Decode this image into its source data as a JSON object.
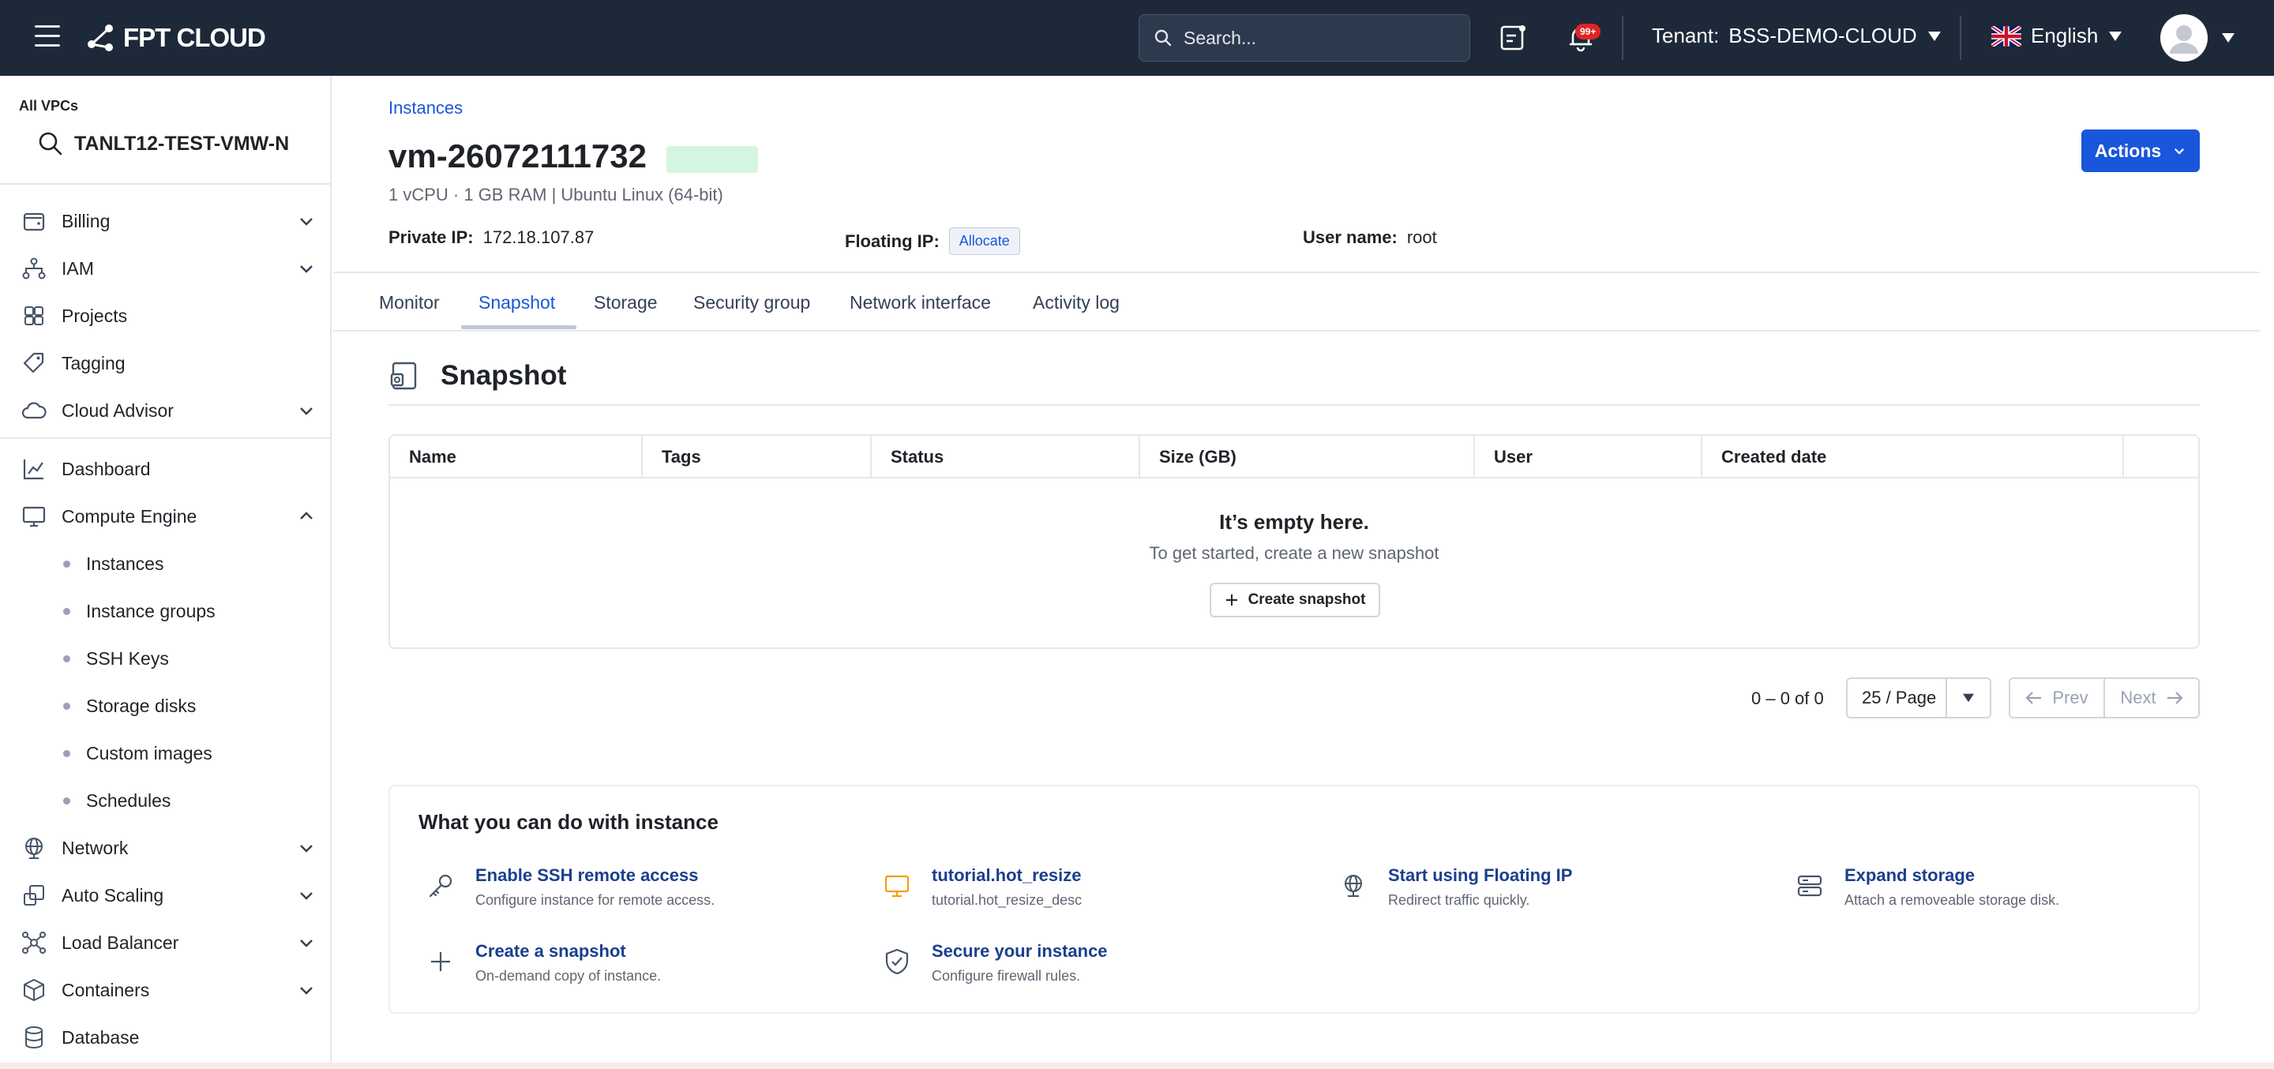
{
  "topbar": {
    "logo_text": "FPT CLOUD",
    "search_placeholder": "Search...",
    "notification_badge": "99+",
    "tenant_label": "Tenant:",
    "tenant_value": "BSS-DEMO-CLOUD",
    "language": "English",
    "colors": {
      "bar": "#1d2939",
      "accent": "#1a56db"
    }
  },
  "sidebar": {
    "vpc_label": "All VPCs",
    "vpc_current": "TANLT12-TEST-VMW-N",
    "items": [
      {
        "label": "Billing",
        "icon": "wallet-icon",
        "expandable": true
      },
      {
        "label": "IAM",
        "icon": "org-chart-icon",
        "expandable": true
      },
      {
        "label": "Projects",
        "icon": "projects-icon",
        "expandable": false
      },
      {
        "label": "Tagging",
        "icon": "tag-icon",
        "expandable": false
      },
      {
        "label": "Cloud Advisor",
        "icon": "cloud-icon",
        "expandable": true
      },
      {
        "label": "Dashboard",
        "icon": "chart-icon",
        "expandable": false
      },
      {
        "label": "Compute Engine",
        "icon": "monitor-icon",
        "expandable": true,
        "expanded": true
      },
      {
        "label": "Network",
        "icon": "globe-icon",
        "expandable": true
      },
      {
        "label": "Auto Scaling",
        "icon": "scaling-icon",
        "expandable": true
      },
      {
        "label": "Load Balancer",
        "icon": "load-balancer-icon",
        "expandable": true
      },
      {
        "label": "Containers",
        "icon": "container-icon",
        "expandable": true
      },
      {
        "label": "Database",
        "icon": "database-icon",
        "expandable": false
      }
    ],
    "compute_sub": [
      "Instances",
      "Instance groups",
      "SSH Keys",
      "Storage disks",
      "Custom images",
      "Schedules"
    ]
  },
  "instance": {
    "breadcrumb": "Instances",
    "name": "vm-26072111732",
    "spec": "1 vCPU · 1 GB RAM | Ubuntu Linux (64-bit)",
    "private_ip_label": "Private IP:",
    "private_ip": "172.18.107.87",
    "floating_ip_label": "Floating IP:",
    "allocate_label": "Allocate",
    "user_name_label": "User name:",
    "user_name": "root",
    "actions_label": "Actions"
  },
  "tabs": [
    "Monitor",
    "Snapshot",
    "Storage",
    "Security group",
    "Network interface",
    "Activity log"
  ],
  "active_tab": "Snapshot",
  "snapshot": {
    "title": "Snapshot",
    "columns": [
      "Name",
      "Tags",
      "Status",
      "Size (GB)",
      "User",
      "Created date"
    ],
    "empty_title": "It’s empty here.",
    "empty_sub": "To get started, create a new snapshot",
    "create_label": "Create snapshot"
  },
  "pagination": {
    "count": "0 – 0 of 0",
    "page_size": "25 / Page",
    "prev": "Prev",
    "next": "Next"
  },
  "guide": {
    "title": "What you can do with instance",
    "items": [
      {
        "title": "Enable SSH remote access",
        "desc": "Configure instance for remote access.",
        "icon": "key-icon"
      },
      {
        "title": "tutorial.hot_resize",
        "desc": "tutorial.hot_resize_desc",
        "icon": "monitor-icon"
      },
      {
        "title": "Start using Floating IP",
        "desc": "Redirect traffic quickly.",
        "icon": "globe-icon"
      },
      {
        "title": "Expand storage",
        "desc": "Attach a removeable storage disk.",
        "icon": "storage-icon"
      },
      {
        "title": "Create a snapshot",
        "desc": "On-demand copy of instance.",
        "icon": "plus-icon"
      },
      {
        "title": "Secure your instance",
        "desc": "Configure firewall rules.",
        "icon": "shield-icon"
      }
    ]
  }
}
